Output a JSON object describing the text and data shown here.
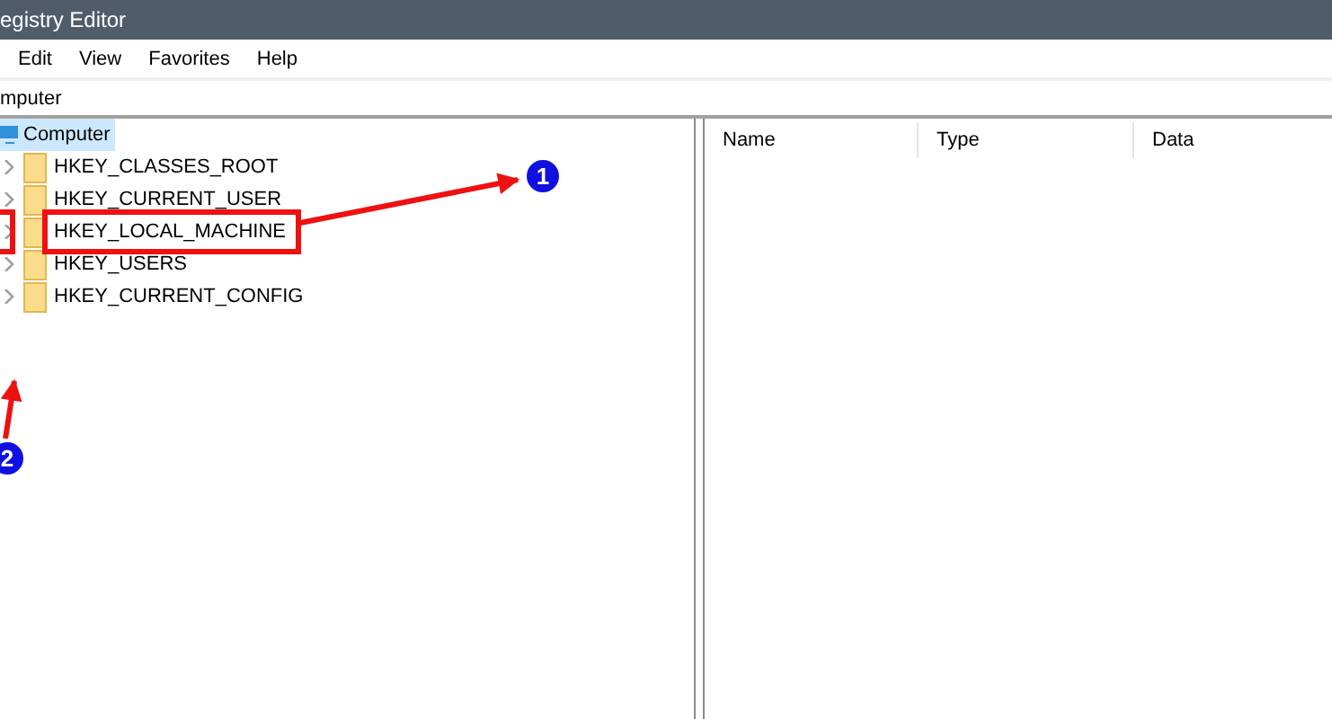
{
  "window": {
    "title": "egistry Editor"
  },
  "menu": [
    "Edit",
    "View",
    "Favorites",
    "Help"
  ],
  "address": "mputer",
  "tree": {
    "label": "Computer",
    "selected": true,
    "children": [
      {
        "label": "HKEY_CLASSES_ROOT",
        "selected": false,
        "expanded": false
      },
      {
        "label": "HKEY_CURRENT_USER",
        "selected": false,
        "expanded": false
      },
      {
        "label": "HKEY_LOCAL_MACHINE",
        "selected": false,
        "expanded": false
      },
      {
        "label": "HKEY_USERS",
        "selected": false,
        "expanded": false
      },
      {
        "label": "HKEY_CURRENT_CONFIG",
        "selected": false,
        "expanded": false
      }
    ]
  },
  "columns": [
    "Name",
    "Type",
    "Data"
  ],
  "annotations": [
    {
      "label": "1"
    },
    {
      "label": "2"
    }
  ]
}
